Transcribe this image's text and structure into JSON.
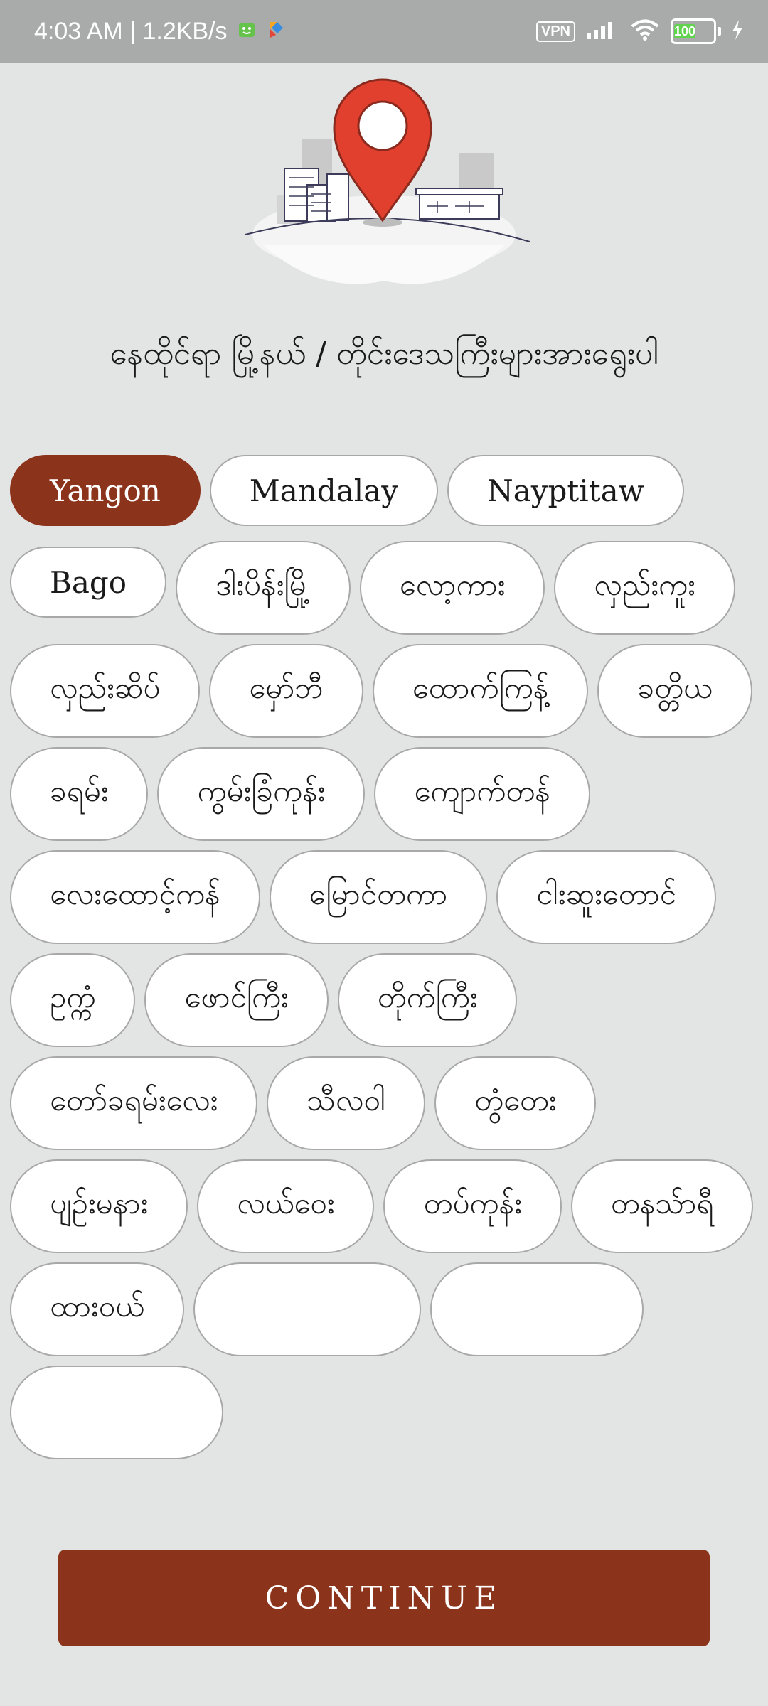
{
  "status_bar": {
    "time_speed": "4:03 AM | 1.2KB/s",
    "vpn": "VPN",
    "battery": "100"
  },
  "heading": "နေထိုင်ရာ မြို့နယ် / တိုင်းဒေသကြီးများအားရွေးပါ",
  "chips": [
    {
      "label": "Yangon",
      "selected": true
    },
    {
      "label": "Mandalay",
      "selected": false
    },
    {
      "label": "Nayptitaw",
      "selected": false
    },
    {
      "label": "Bago",
      "selected": false
    },
    {
      "label": "ဒါးပိန်းမြို့",
      "selected": false
    },
    {
      "label": "လော့ကား",
      "selected": false
    },
    {
      "label": "လှည်းကူး",
      "selected": false
    },
    {
      "label": "လှည်းဆိပ်",
      "selected": false
    },
    {
      "label": "မှော်ဘီ",
      "selected": false
    },
    {
      "label": "ထောက်ကြန့်",
      "selected": false
    },
    {
      "label": "ခတ္တိယ",
      "selected": false
    },
    {
      "label": "ခရမ်း",
      "selected": false
    },
    {
      "label": "ကွမ်းခြံကုန်း",
      "selected": false
    },
    {
      "label": "ကျောက်တန်",
      "selected": false
    },
    {
      "label": "လေးထောင့်ကန်",
      "selected": false
    },
    {
      "label": "မြောင်တကာ",
      "selected": false
    },
    {
      "label": "ငါးဆူးတောင်",
      "selected": false
    },
    {
      "label": "ဥက္ကံ",
      "selected": false
    },
    {
      "label": "ဖောင်ကြီး",
      "selected": false
    },
    {
      "label": "တိုက်ကြီး",
      "selected": false
    },
    {
      "label": "တော်ခရမ်းလေး",
      "selected": false
    },
    {
      "label": "သီလဝါ",
      "selected": false
    },
    {
      "label": "တွံတေး",
      "selected": false
    },
    {
      "label": "ပျဉ်းမနား",
      "selected": false
    },
    {
      "label": "လယ်ဝေး",
      "selected": false
    },
    {
      "label": "တပ်ကုန်း",
      "selected": false
    },
    {
      "label": "တနသ်ာရီ",
      "selected": false
    },
    {
      "label": "ထားဝယ်",
      "selected": false
    },
    {
      "label": "",
      "selected": false
    },
    {
      "label": "",
      "selected": false
    },
    {
      "label": "",
      "selected": false
    }
  ],
  "continue_label": "CONTINUE",
  "colors": {
    "accent": "#8c331b",
    "background": "#e3e5e5",
    "status_bar": "#a9abab"
  }
}
